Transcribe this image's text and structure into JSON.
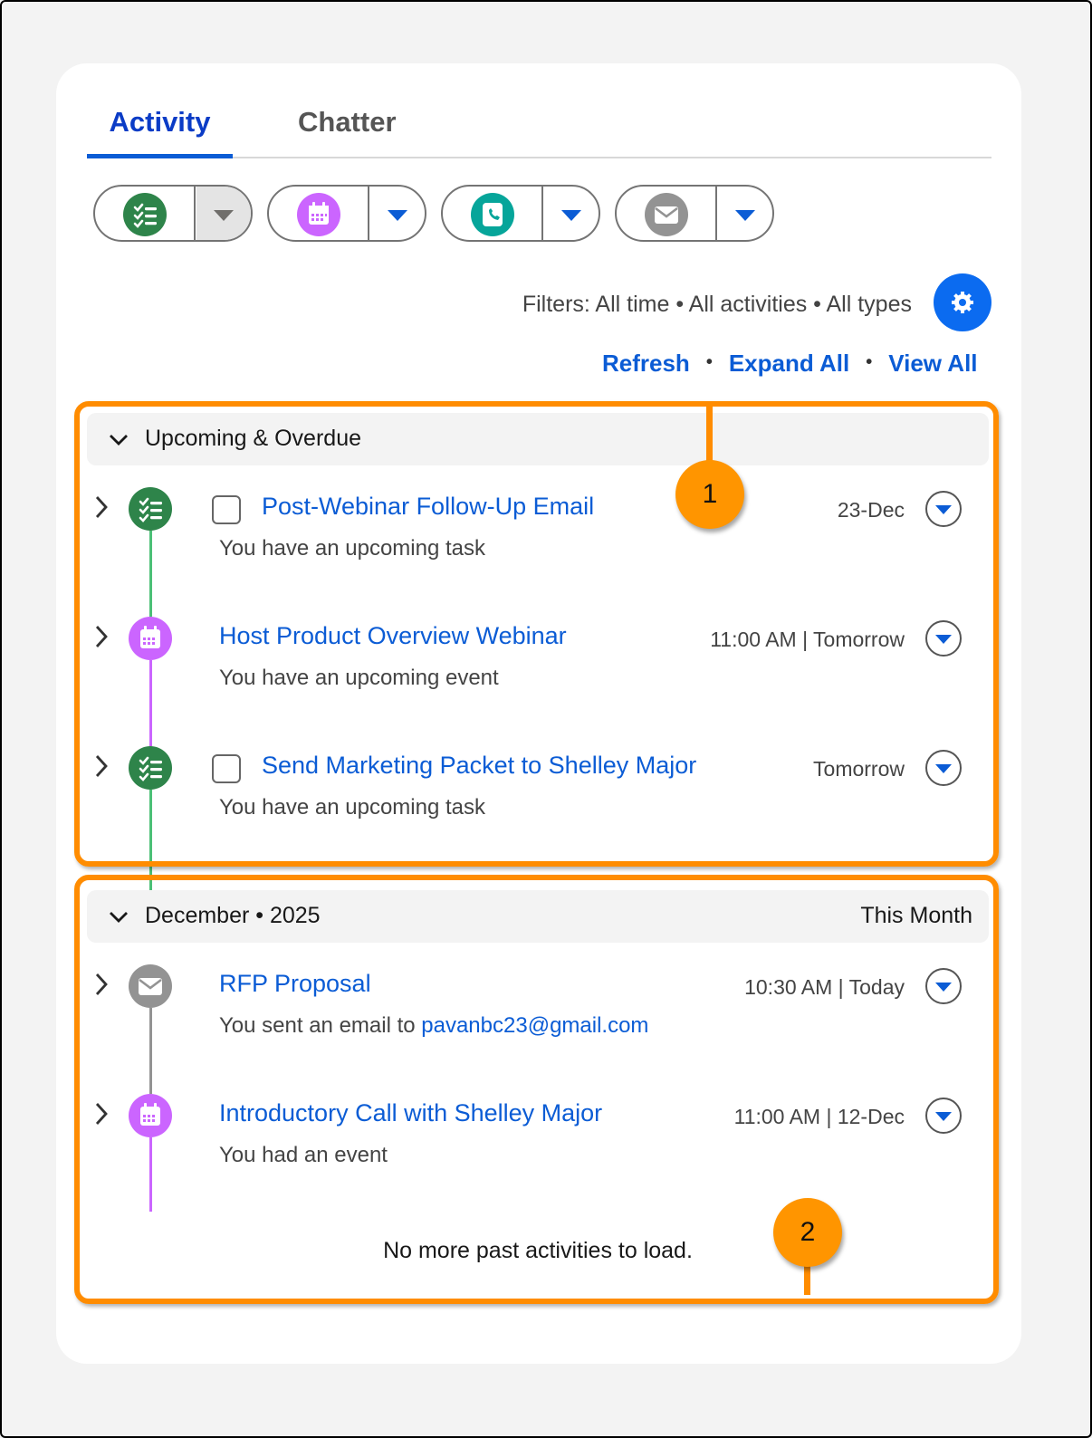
{
  "tabs": [
    {
      "label": "Activity",
      "active": true
    },
    {
      "label": "Chatter",
      "active": false
    }
  ],
  "action_buttons": [
    {
      "icon": "new-task-icon",
      "color": "#2e844a"
    },
    {
      "icon": "new-event-icon",
      "color": "#cb65ff"
    },
    {
      "icon": "log-call-icon",
      "color": "#06a59a"
    },
    {
      "icon": "email-icon",
      "color": "#939393"
    }
  ],
  "filters": {
    "text": "Filters: All time • All activities • All types",
    "settings_icon": "gear-icon"
  },
  "links": {
    "refresh": "Refresh",
    "expand_all": "Expand All",
    "view_all": "View All",
    "separator": "•"
  },
  "sections": [
    {
      "title": "Upcoming & Overdue",
      "right_label": "",
      "items": [
        {
          "type": "task",
          "title": "Post-Webinar Follow-Up Email",
          "subtitle": "You have an upcoming task",
          "date": "23-Dec",
          "color": "#2e844a"
        },
        {
          "type": "event",
          "title": "Host Product Overview Webinar",
          "subtitle": "You have an upcoming event",
          "date": "11:00 AM | Tomorrow",
          "color": "#cb65ff"
        },
        {
          "type": "task",
          "title": "Send Marketing Packet to Shelley Major",
          "subtitle": "You have an upcoming task",
          "date": "Tomorrow",
          "color": "#2e844a"
        }
      ]
    },
    {
      "title": "December • 2025",
      "right_label": "This Month",
      "items": [
        {
          "type": "email",
          "title": "RFP Proposal",
          "subtitle": "You sent an email to ",
          "subtitle_link": "pavanbc23@gmail.com",
          "date": "10:30 AM | Today",
          "color": "#939393"
        },
        {
          "type": "event",
          "title": "Introductory Call with Shelley Major",
          "subtitle": "You had an event",
          "date": "11:00 AM | 12-Dec",
          "color": "#cb65ff"
        }
      ],
      "footer": "No more past activities to load."
    }
  ],
  "callouts": [
    {
      "number": "1"
    },
    {
      "number": "2"
    }
  ],
  "colors": {
    "accent": "#0b5cd5",
    "callout": "#ff8c00"
  }
}
